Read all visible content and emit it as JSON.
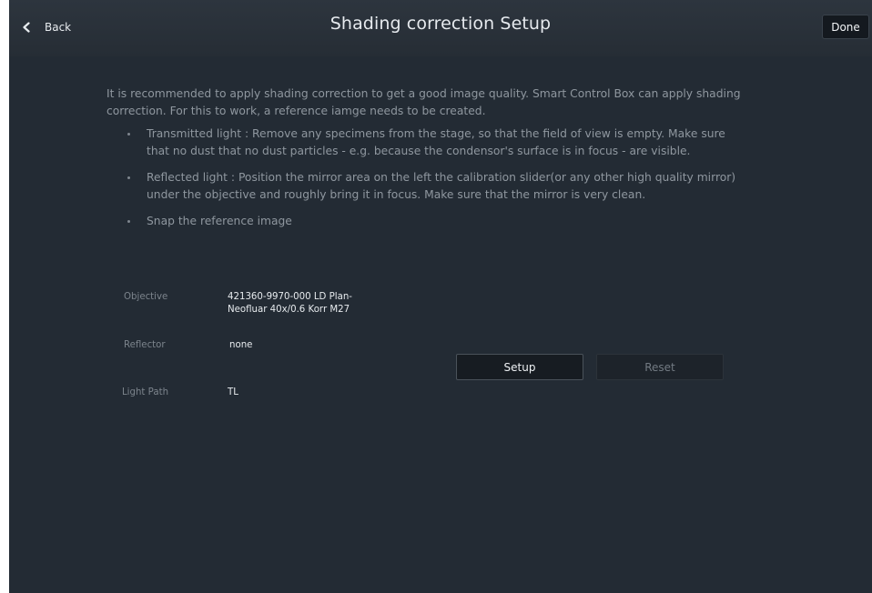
{
  "header": {
    "back_label": "Back",
    "title": "Shading correction Setup",
    "done_label": "Done"
  },
  "intro": "It is recommended to apply shading correction to get a good image quality. Smart Control Box can apply shading correction. For this to work, a reference iamge needs to be created.",
  "instructions": [
    "Transmitted light : Remove any specimens from the stage, so that the field of view is empty. Make sure that no dust that no dust particles - e.g. because the condensor's surface is in focus - are visible.",
    "Reflected light : Position the mirror area on the left the calibration slider(or any other high quality mirror) under the objective and roughly bring it in focus. Make sure that the mirror is very clean.",
    "Snap the reference image"
  ],
  "params": {
    "objective_label": "Objective",
    "objective_value": "421360-9970-000 LD Plan-Neofluar 40x/0.6 Korr M27",
    "reflector_label": "Reflector",
    "reflector_value": "none",
    "lightpath_label": "Light Path",
    "lightpath_value": "TL"
  },
  "actions": {
    "setup_label": "Setup",
    "reset_label": "Reset"
  },
  "colors": {
    "background": "#232b34",
    "header": "#2a3139",
    "text_dim": "#8f979f",
    "text_bright": "#e7ebee"
  }
}
